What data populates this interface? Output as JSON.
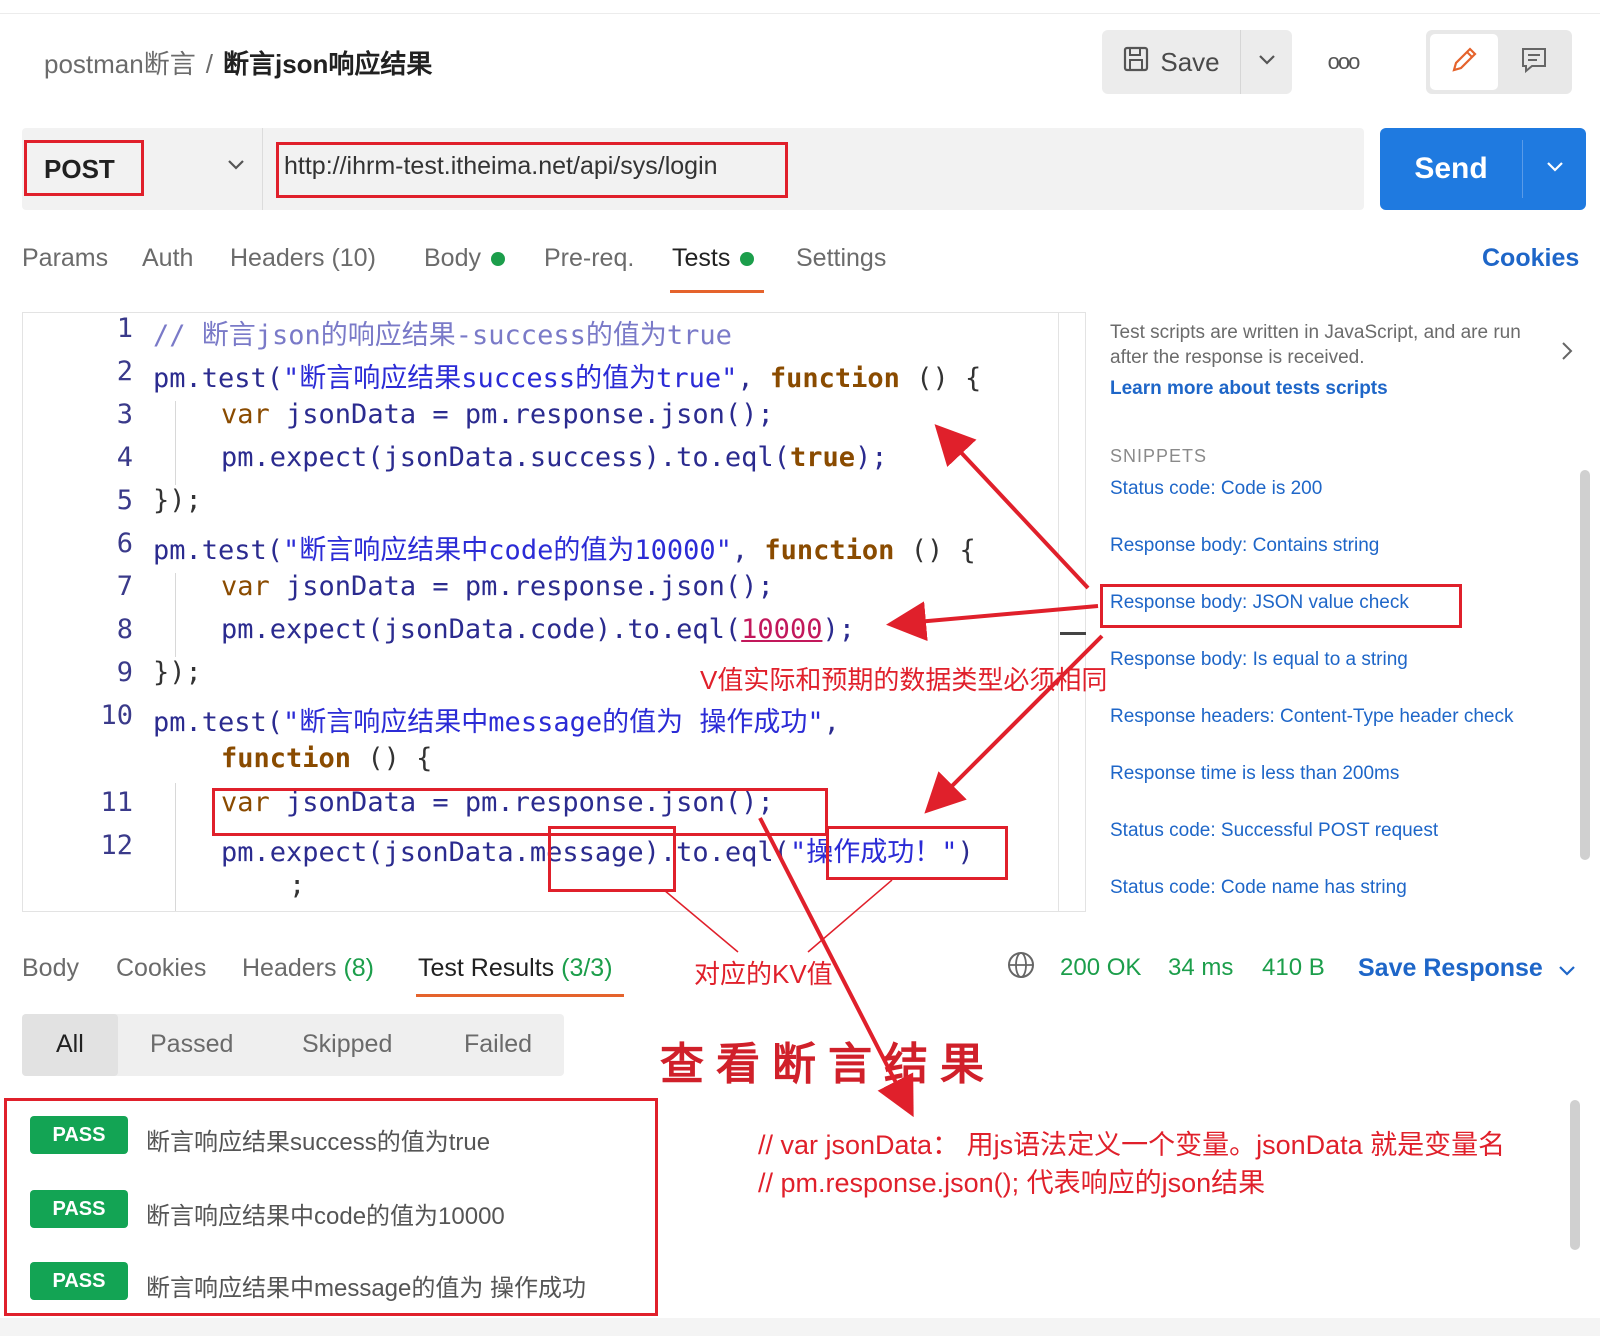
{
  "header": {
    "collection": "postman断言",
    "separator": "/",
    "request_name": "断言json响应结果",
    "save_label": "Save",
    "more_label": "ooo"
  },
  "request": {
    "method": "POST",
    "url": "http://ihrm-test.itheima.net/api/sys/login",
    "send_label": "Send"
  },
  "tabs": {
    "params": "Params",
    "auth": "Auth",
    "headers": "Headers",
    "headers_count": "(10)",
    "body": "Body",
    "prereq": "Pre-req.",
    "tests": "Tests",
    "settings": "Settings",
    "cookies": "Cookies"
  },
  "editor": {
    "line_numbers": [
      "1",
      "2",
      "3",
      "4",
      "5",
      "6",
      "7",
      "8",
      "9",
      "10",
      "11",
      "12"
    ]
  },
  "sidebar": {
    "description": "Test scripts are written in JavaScript, and are run after the response is received.",
    "learn_more": "Learn more about tests scripts",
    "snippets_title": "SNIPPETS",
    "snippets": [
      "Status code: Code is 200",
      "Response body: Contains string",
      "Response body: JSON value check",
      "Response body: Is equal to a string",
      "Response headers: Content-Type header check",
      "Response time is less than 200ms",
      "Status code: Successful POST request",
      "Status code: Code name has string"
    ]
  },
  "response": {
    "tabs": {
      "body": "Body",
      "cookies": "Cookies",
      "headers": "Headers",
      "headers_count": "(8)",
      "test_results": "Test Results",
      "test_results_count": "(3/3)"
    },
    "status": "200 OK",
    "time": "34 ms",
    "size": "410 B",
    "save_response": "Save Response",
    "filters": [
      "All",
      "Passed",
      "Skipped",
      "Failed"
    ],
    "results": [
      {
        "badge": "PASS",
        "text": "断言响应结果success的值为true"
      },
      {
        "badge": "PASS",
        "text": "断言响应结果中code的值为10000"
      },
      {
        "badge": "PASS",
        "text": "断言响应结果中message的值为 操作成功"
      }
    ]
  },
  "annotations": {
    "type_note": "V值实际和预期的数据类型必须相同",
    "kv_note": "对应的KV值",
    "view_results": "查看断言结果",
    "comment_line1": "// var jsonData： 用js语法定义一个变量。jsonData 就是变量名",
    "comment_line2": "// pm.response.json(); 代表响应的json结果"
  },
  "colors": {
    "accent_blue": "#1f7ae0",
    "pass_green": "#13a454",
    "annotation_red": "#e0202b",
    "active_tab_underline": "#e5632c"
  }
}
